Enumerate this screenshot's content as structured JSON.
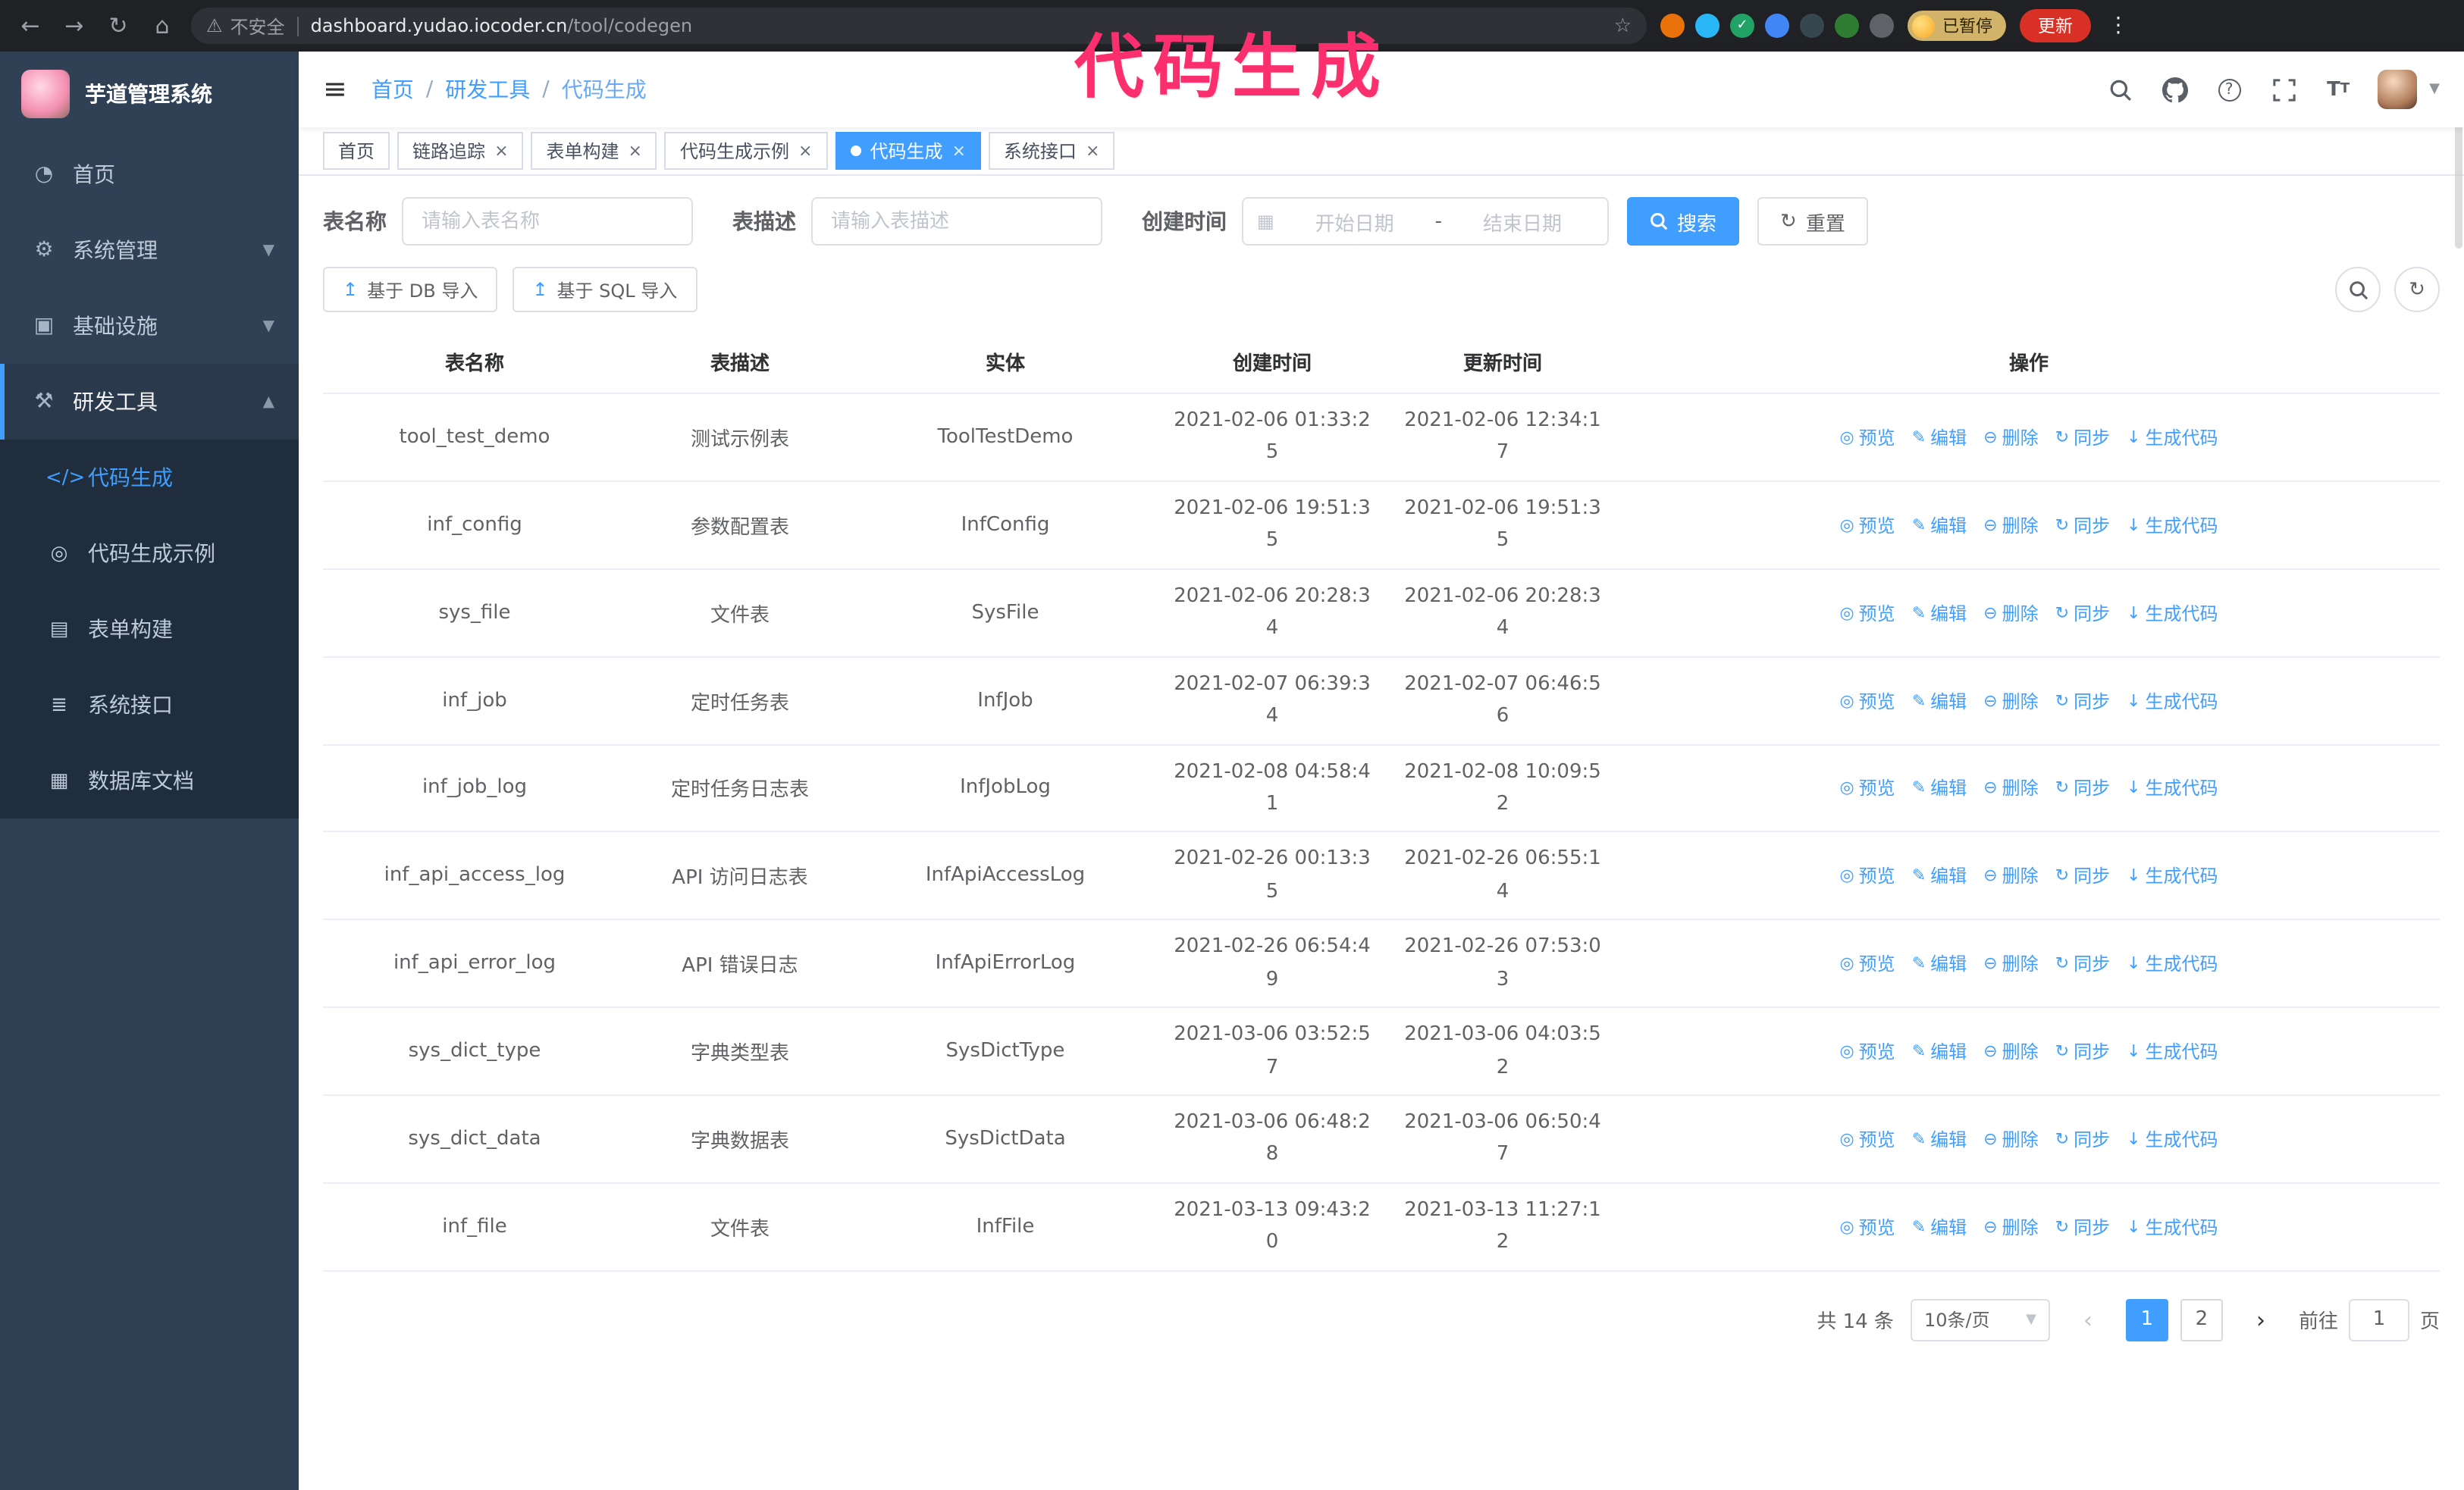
{
  "colors": {
    "primary": "#409eff",
    "annotation": "#fb2f6e",
    "sidebar_bg": "#304156",
    "submenu_bg": "#1f2d3d"
  },
  "browser": {
    "warning": "不安全",
    "url_host": "dashboard.yudao.iocoder.cn",
    "url_path": "/tool/codegen",
    "paused_badge": "已暂停",
    "update_button": "更新",
    "extensions": [
      {
        "name": "extension-orange",
        "color": "#e8710a",
        "glyph": ""
      },
      {
        "name": "extension-blue-drop",
        "color": "#29b6f6",
        "glyph": ""
      },
      {
        "name": "extension-green-check",
        "color": "#21a366",
        "glyph": "✓"
      },
      {
        "name": "extension-people",
        "color": "#4285f4",
        "glyph": ""
      },
      {
        "name": "extension-dark",
        "color": "#37474f",
        "glyph": ""
      },
      {
        "name": "extension-leaf",
        "color": "#2e7d32",
        "glyph": ""
      },
      {
        "name": "extension-puzzle",
        "color": "#5f6368",
        "glyph": ""
      }
    ]
  },
  "annotation": {
    "text": "代码生成"
  },
  "sidebar": {
    "title": "芋道管理系统",
    "items": [
      {
        "label": "首页",
        "icon": "home-icon",
        "group": false,
        "state": "none"
      },
      {
        "label": "系统管理",
        "icon": "gear-icon",
        "group": true,
        "state": "collapsed"
      },
      {
        "label": "基础设施",
        "icon": "infra-icon",
        "group": true,
        "state": "collapsed"
      },
      {
        "label": "研发工具",
        "icon": "tools-icon",
        "group": true,
        "state": "expanded"
      }
    ],
    "submenu": [
      {
        "label": "代码生成",
        "icon": "code-icon",
        "active": true
      },
      {
        "label": "代码生成示例",
        "icon": "example-icon",
        "active": false
      },
      {
        "label": "表单构建",
        "icon": "form-icon",
        "active": false
      },
      {
        "label": "系统接口",
        "icon": "api-icon",
        "active": false
      },
      {
        "label": "数据库文档",
        "icon": "dbdoc-icon",
        "active": false
      }
    ]
  },
  "topbar": {
    "breadcrumb": [
      "首页",
      "研发工具",
      "代码生成"
    ]
  },
  "tabs": [
    {
      "label": "首页",
      "active": false,
      "closable": false
    },
    {
      "label": "链路追踪",
      "active": false,
      "closable": true
    },
    {
      "label": "表单构建",
      "active": false,
      "closable": true
    },
    {
      "label": "代码生成示例",
      "active": false,
      "closable": true
    },
    {
      "label": "代码生成",
      "active": true,
      "closable": true
    },
    {
      "label": "系统接口",
      "active": false,
      "closable": true
    }
  ],
  "filters": {
    "table_name_label": "表名称",
    "table_name_placeholder": "请输入表名称",
    "table_desc_label": "表描述",
    "table_desc_placeholder": "请输入表描述",
    "create_time_label": "创建时间",
    "start_date_placeholder": "开始日期",
    "range_separator": "-",
    "end_date_placeholder": "结束日期",
    "search_button": "搜索",
    "reset_button": "重置"
  },
  "import_buttons": {
    "db": "基于 DB 导入",
    "sql": "基于 SQL 导入"
  },
  "table": {
    "columns": [
      "表名称",
      "表描述",
      "实体",
      "创建时间",
      "更新时间",
      "操作"
    ],
    "row_actions": [
      {
        "label": "预览",
        "icon": "eye-icon"
      },
      {
        "label": "编辑",
        "icon": "edit-icon"
      },
      {
        "label": "删除",
        "icon": "trash-icon"
      },
      {
        "label": "同步",
        "icon": "sync-icon"
      },
      {
        "label": "生成代码",
        "icon": "download-icon"
      }
    ],
    "rows": [
      {
        "name": "tool_test_demo",
        "desc": "测试示例表",
        "entity": "ToolTestDemo",
        "created": "2021-02-06 01:33:25",
        "updated": "2021-02-06 12:34:17"
      },
      {
        "name": "inf_config",
        "desc": "参数配置表",
        "entity": "InfConfig",
        "created": "2021-02-06 19:51:35",
        "updated": "2021-02-06 19:51:35"
      },
      {
        "name": "sys_file",
        "desc": "文件表",
        "entity": "SysFile",
        "created": "2021-02-06 20:28:34",
        "updated": "2021-02-06 20:28:34"
      },
      {
        "name": "inf_job",
        "desc": "定时任务表",
        "entity": "InfJob",
        "created": "2021-02-07 06:39:34",
        "updated": "2021-02-07 06:46:56"
      },
      {
        "name": "inf_job_log",
        "desc": "定时任务日志表",
        "entity": "InfJobLog",
        "created": "2021-02-08 04:58:41",
        "updated": "2021-02-08 10:09:52"
      },
      {
        "name": "inf_api_access_log",
        "desc": "API 访问日志表",
        "entity": "InfApiAccessLog",
        "created": "2021-02-26 00:13:35",
        "updated": "2021-02-26 06:55:14"
      },
      {
        "name": "inf_api_error_log",
        "desc": "API 错误日志",
        "entity": "InfApiErrorLog",
        "created": "2021-02-26 06:54:49",
        "updated": "2021-02-26 07:53:03"
      },
      {
        "name": "sys_dict_type",
        "desc": "字典类型表",
        "entity": "SysDictType",
        "created": "2021-03-06 03:52:57",
        "updated": "2021-03-06 04:03:52"
      },
      {
        "name": "sys_dict_data",
        "desc": "字典数据表",
        "entity": "SysDictData",
        "created": "2021-03-06 06:48:28",
        "updated": "2021-03-06 06:50:47"
      },
      {
        "name": "inf_file",
        "desc": "文件表",
        "entity": "InfFile",
        "created": "2021-03-13 09:43:20",
        "updated": "2021-03-13 11:27:12"
      }
    ]
  },
  "pagination": {
    "total": "共 14 条",
    "page_size": "10条/页",
    "pages": [
      "1",
      "2"
    ],
    "current": "1",
    "goto_label": "前往",
    "goto_value": "1",
    "goto_suffix": "页"
  }
}
